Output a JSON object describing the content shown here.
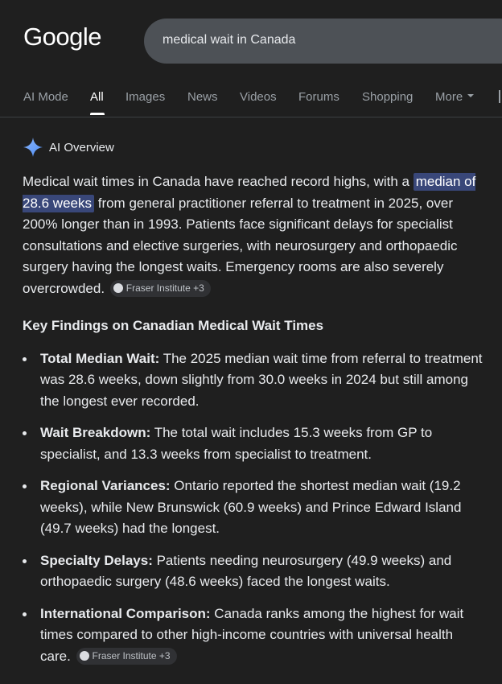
{
  "header": {
    "logo": "Google",
    "search_query": "medical wait in Canada"
  },
  "tabs": [
    {
      "label": "AI Mode",
      "active": false
    },
    {
      "label": "All",
      "active": true
    },
    {
      "label": "Images",
      "active": false
    },
    {
      "label": "News",
      "active": false
    },
    {
      "label": "Videos",
      "active": false
    },
    {
      "label": "Forums",
      "active": false
    },
    {
      "label": "Shopping",
      "active": false
    },
    {
      "label": "More",
      "active": false
    }
  ],
  "ai_overview": {
    "title": "AI Overview",
    "intro_before": "Medical wait times in Canada have reached record highs, with a ",
    "intro_highlight": "median of 28.6 weeks",
    "intro_after": " from general practitioner referral to treatment in 2025, over 200% longer than in 1993. Patients face significant delays for specialist consultations and elective surgeries, with neurosurgery and orthopaedic surgery having the longest waits. Emergency rooms are also severely overcrowded. ",
    "intro_source": "Fraser Institute +3",
    "section_heading": "Key Findings on Canadian Medical Wait Times",
    "findings": [
      {
        "term": "Total Median Wait:",
        "text": " The 2025 median wait time from referral to treatment was 28.6 weeks, down slightly from 30.0 weeks in 2024 but still among the longest ever recorded."
      },
      {
        "term": "Wait Breakdown:",
        "text": " The total wait includes 15.3 weeks from GP to specialist, and 13.3 weeks from specialist to treatment."
      },
      {
        "term": "Regional Variances:",
        "text": " Ontario reported the shortest median wait (19.2 weeks), while New Brunswick (60.9 weeks) and Prince Edward Island (49.7 weeks) had the longest."
      },
      {
        "term": "Specialty Delays:",
        "text": " Patients needing neurosurgery (49.9 weeks) and orthopaedic surgery (48.6 weeks) faced the longest waits."
      },
      {
        "term": "International Comparison:",
        "text": " Canada ranks among the highest for wait times compared to other high-income countries with universal health care. ",
        "source": "Fraser Institute +3"
      }
    ]
  },
  "colors": {
    "background": "#1f1f1f",
    "search_box": "#4d5156",
    "highlight": "#394779",
    "sparkle": "#4f8ff7"
  }
}
